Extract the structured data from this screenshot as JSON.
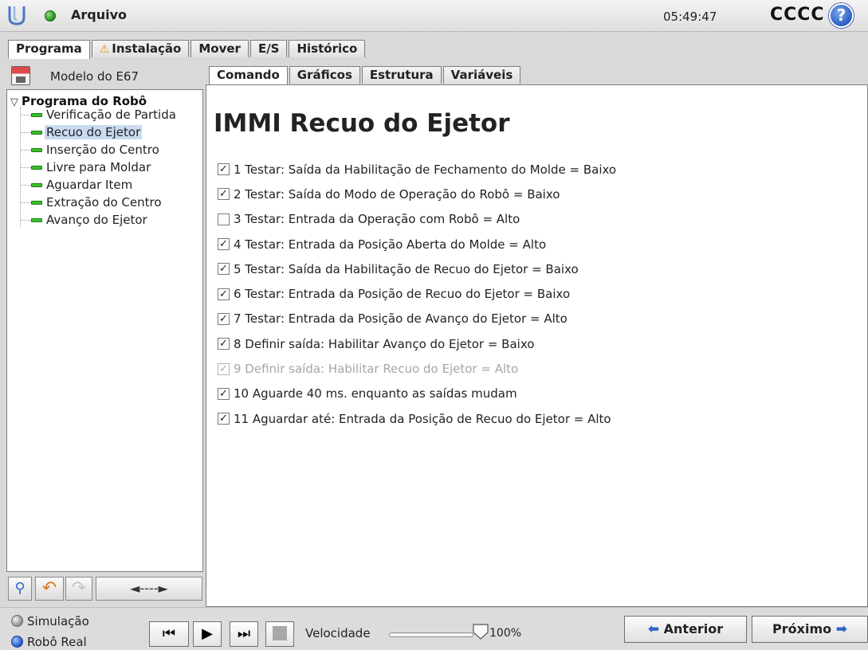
{
  "header": {
    "file_menu": "Arquivo",
    "clock": "05:49:47",
    "robot_name": "CCCC",
    "help": "?"
  },
  "main_tabs": [
    {
      "label": "Programa",
      "active": true
    },
    {
      "label": "Instalação",
      "warning": true
    },
    {
      "label": "Mover"
    },
    {
      "label": "E/S"
    },
    {
      "label": "Histórico"
    }
  ],
  "left_panel": {
    "model_name": "Modelo do E67",
    "tree_root": "Programa do Robô",
    "tree_items": [
      {
        "label": "Verificação de Partida"
      },
      {
        "label": "Recuo do Ejetor",
        "selected": true
      },
      {
        "label": "Inserção do Centro"
      },
      {
        "label": "Livre para Moldar"
      },
      {
        "label": "Aguardar Item"
      },
      {
        "label": "Extração do Centro"
      },
      {
        "label": "Avanço do Ejetor"
      }
    ],
    "tools": {
      "move_label": "◄----►"
    }
  },
  "sub_tabs": [
    {
      "label": "Comando",
      "active": true
    },
    {
      "label": "Gráficos"
    },
    {
      "label": "Estrutura"
    },
    {
      "label": "Variáveis"
    }
  ],
  "content": {
    "title": "IMMI Recuo do Ejetor",
    "checklist": [
      {
        "label": "1 Testar: Saída da Habilitação de Fechamento do Molde = Baixo",
        "checked": true
      },
      {
        "label": "2 Testar: Saída do Modo de Operação do Robô = Baixo",
        "checked": true
      },
      {
        "label": "3 Testar: Entrada da Operação com Robô = Alto",
        "checked": false
      },
      {
        "label": "4 Testar: Entrada da Posição Aberta do Molde = Alto",
        "checked": true
      },
      {
        "label": "5 Testar: Saída da Habilitação de Recuo do Ejetor = Baixo",
        "checked": true
      },
      {
        "label": "6 Testar: Entrada da Posição de Recuo do Ejetor = Baixo",
        "checked": true
      },
      {
        "label": "7 Testar: Entrada da Posição de Avanço do Ejetor = Alto",
        "checked": true
      },
      {
        "label": "8 Definir saída: Habilitar Avanço do Ejetor = Baixo",
        "checked": true
      },
      {
        "label": "9 Definir saída: Habilitar Recuo do Ejetor = Alto",
        "checked": true,
        "disabled": true
      },
      {
        "label": "10 Aguarde 40 ms. enquanto as saídas mudam",
        "checked": true
      },
      {
        "label": "11 Aguardar até: Entrada da Posição de Recuo do Ejetor = Alto",
        "checked": true
      }
    ]
  },
  "footer": {
    "mode_sim": "Simulação",
    "mode_real": "Robô Real",
    "speed_label": "Velocidade",
    "speed_value": "100%",
    "speed_fraction": 1.0,
    "back_label": "Anterior",
    "next_label": "Próximo"
  },
  "colors": {
    "accent_blue": "#2f63c6",
    "status_green": "#2f9a24",
    "selection": "#c9daf1",
    "warning": "#d6a000"
  }
}
